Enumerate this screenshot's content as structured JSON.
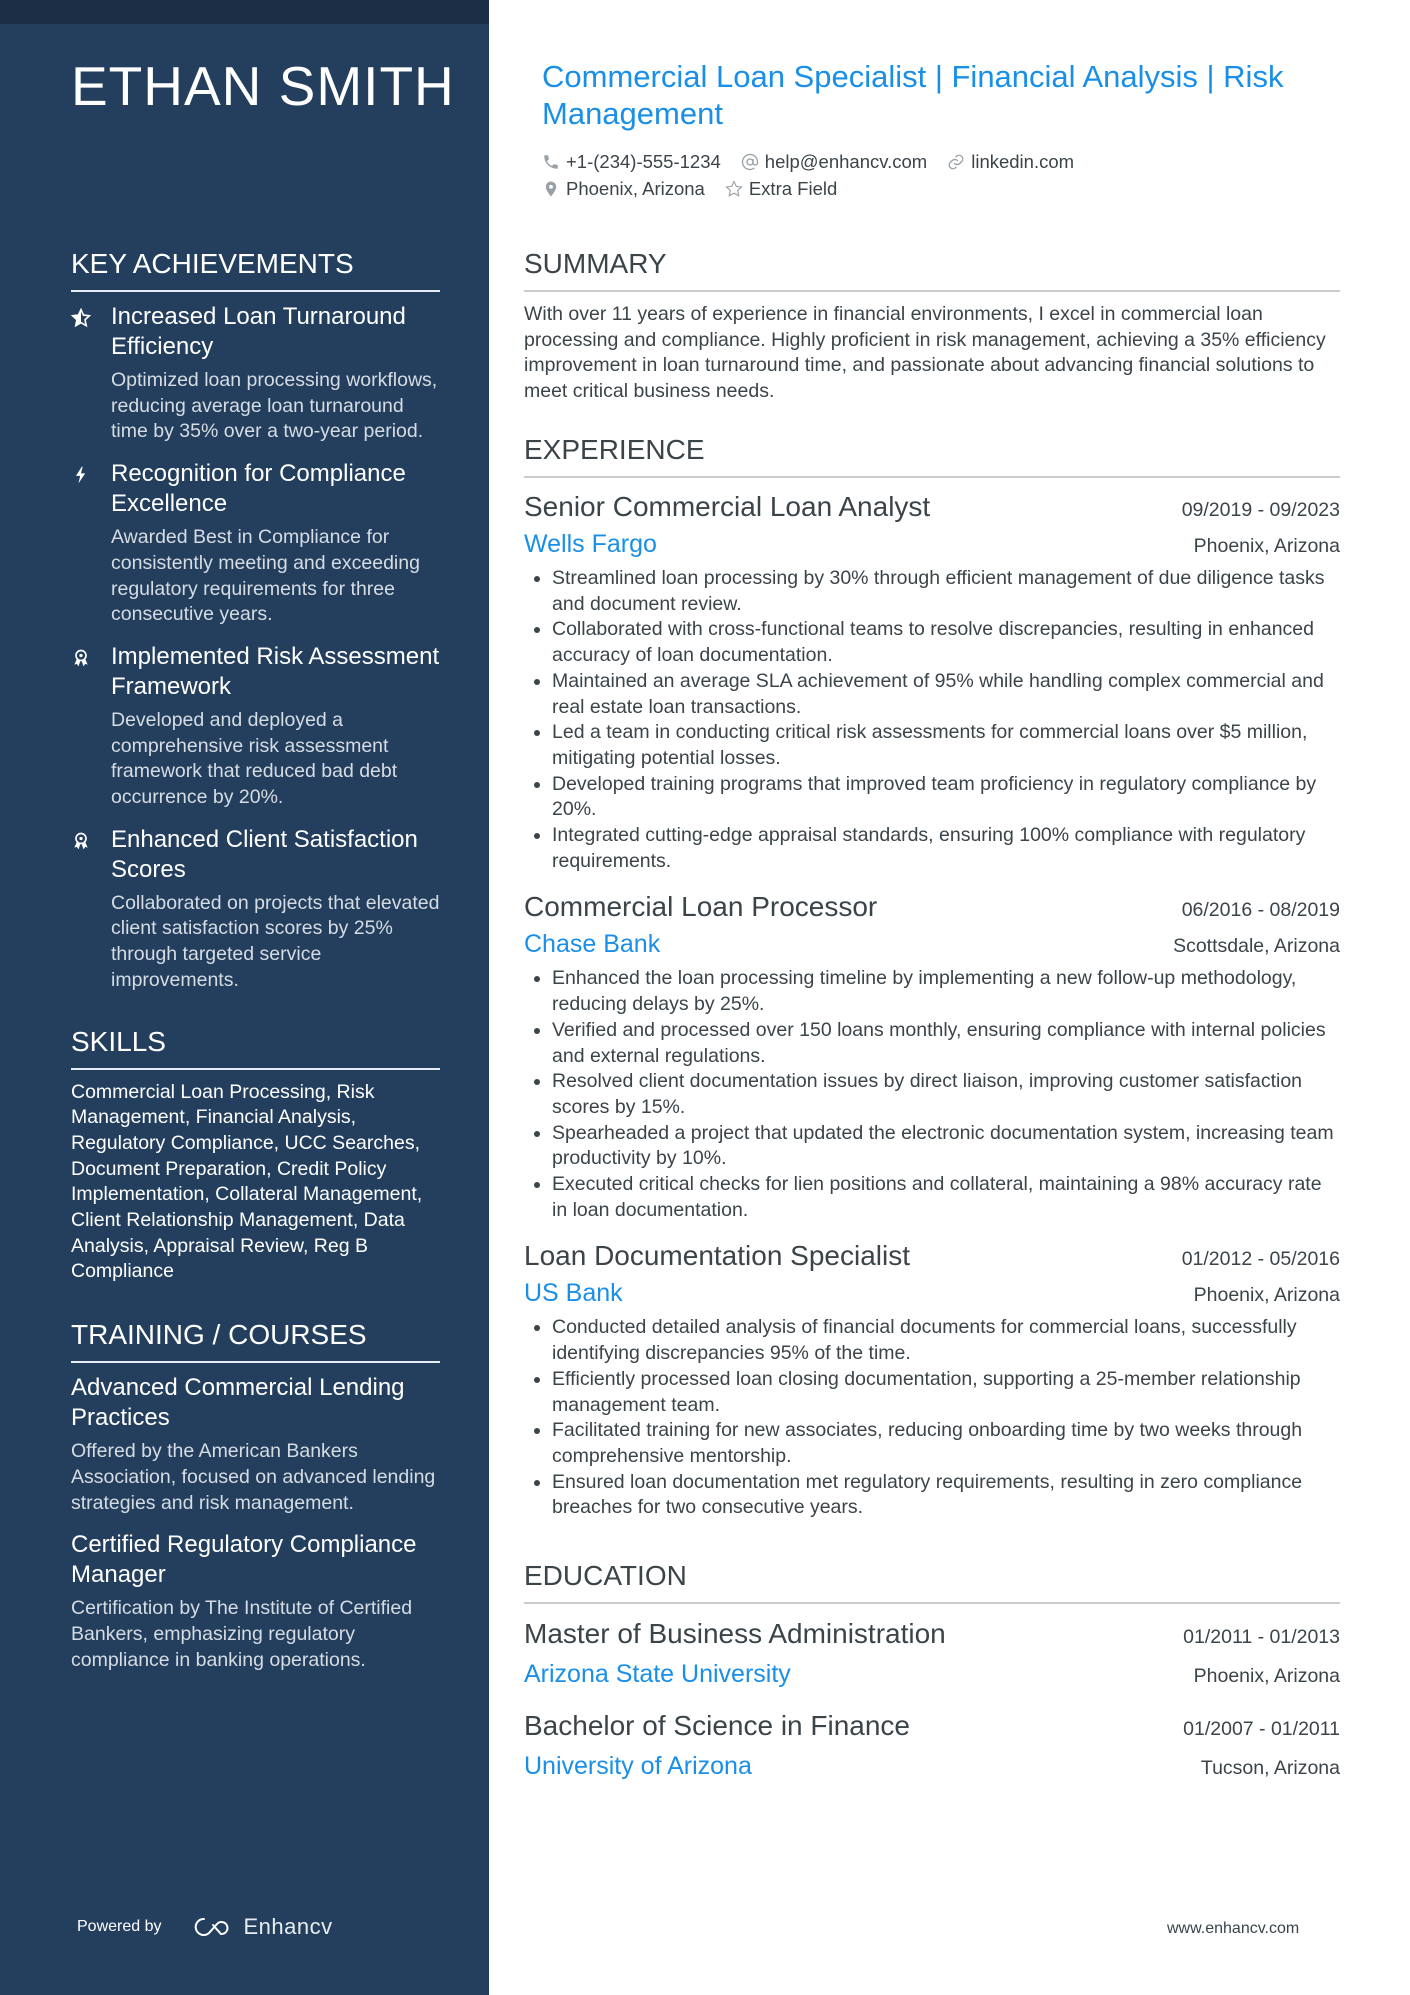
{
  "colors": {
    "sidebar_bg": "#233f5d",
    "sidebar_strip": "#1b2e45",
    "accent": "#1a8fe8",
    "text": "#3b4449"
  },
  "name": "ETHAN SMITH",
  "headline": "Commercial Loan Specialist | Financial Analysis | Risk Management",
  "contacts": {
    "phone": {
      "icon": "phone-icon",
      "value": "+1-(234)-555-1234"
    },
    "email": {
      "icon": "at-icon",
      "value": "help@enhancv.com"
    },
    "link": {
      "icon": "link-icon",
      "value": "linkedin.com"
    },
    "location": {
      "icon": "location-pin-icon",
      "value": "Phoenix, Arizona"
    },
    "extra": {
      "icon": "star-icon",
      "value": "Extra Field"
    }
  },
  "key_achievements": {
    "title": "KEY ACHIEVEMENTS",
    "items": [
      {
        "icon": "star-half-icon",
        "title": "Increased Loan Turnaround Efficiency",
        "description": "Optimized loan processing workflows, reducing average loan turnaround time by 35% over a two-year period."
      },
      {
        "icon": "lightning-icon",
        "title": "Recognition for Compliance Excellence",
        "description": "Awarded Best in Compliance for consistently meeting and exceeding regulatory requirements for three consecutive years."
      },
      {
        "icon": "award-ribbon-icon",
        "title": "Implemented Risk Assessment Framework",
        "description": "Developed and deployed a comprehensive risk assessment framework that reduced bad debt occurrence by 20%."
      },
      {
        "icon": "award-ribbon-icon",
        "title": "Enhanced Client Satisfaction Scores",
        "description": "Collaborated on projects that elevated client satisfaction scores by 25% through targeted service improvements."
      }
    ]
  },
  "skills": {
    "title": "SKILLS",
    "text": "Commercial Loan Processing, Risk Management, Financial Analysis, Regulatory Compliance, UCC Searches, Document Preparation, Credit Policy Implementation, Collateral Management, Client Relationship Management, Data Analysis, Appraisal Review, Reg B Compliance"
  },
  "training": {
    "title": "TRAINING / COURSES",
    "items": [
      {
        "title": "Advanced Commercial Lending Practices",
        "description": "Offered by the American Bankers Association, focused on advanced lending strategies and risk management."
      },
      {
        "title": "Certified Regulatory Compliance Manager",
        "description": "Certification by The Institute of Certified Bankers, emphasizing regulatory compliance in banking operations."
      }
    ]
  },
  "powered_by": {
    "label": "Powered by",
    "brand": "Enhancv"
  },
  "summary": {
    "title": "SUMMARY",
    "text": "With over 11 years of experience in financial environments, I excel in commercial loan processing and compliance. Highly proficient in risk management, achieving a 35% efficiency improvement in loan turnaround time, and passionate about advancing financial solutions to meet critical business needs."
  },
  "experience": {
    "title": "EXPERIENCE",
    "jobs": [
      {
        "title": "Senior Commercial Loan Analyst",
        "dates": "09/2019 - 09/2023",
        "company": "Wells Fargo",
        "location": "Phoenix, Arizona",
        "bullets": [
          "Streamlined loan processing by 30% through efficient management of due diligence tasks and document review.",
          "Collaborated with cross-functional teams to resolve discrepancies, resulting in enhanced accuracy of loan documentation.",
          "Maintained an average SLA achievement of 95% while handling complex commercial and real estate loan transactions.",
          "Led a team in conducting critical risk assessments for commercial loans over $5 million, mitigating potential losses.",
          "Developed training programs that improved team proficiency in regulatory compliance by 20%.",
          "Integrated cutting-edge appraisal standards, ensuring 100% compliance with regulatory requirements."
        ]
      },
      {
        "title": "Commercial Loan Processor",
        "dates": "06/2016 - 08/2019",
        "company": "Chase Bank",
        "location": "Scottsdale, Arizona",
        "bullets": [
          "Enhanced the loan processing timeline by implementing a new follow-up methodology, reducing delays by 25%.",
          "Verified and processed over 150 loans monthly, ensuring compliance with internal policies and external regulations.",
          "Resolved client documentation issues by direct liaison, improving customer satisfaction scores by 15%.",
          "Spearheaded a project that updated the electronic documentation system, increasing team productivity by 10%.",
          "Executed critical checks for lien positions and collateral, maintaining a 98% accuracy rate in loan documentation."
        ]
      },
      {
        "title": "Loan Documentation Specialist",
        "dates": "01/2012 - 05/2016",
        "company": "US Bank",
        "location": "Phoenix, Arizona",
        "bullets": [
          "Conducted detailed analysis of financial documents for commercial loans, successfully identifying discrepancies 95% of the time.",
          "Efficiently processed loan closing documentation, supporting a 25-member relationship management team.",
          "Facilitated training for new associates, reducing onboarding time by two weeks through comprehensive mentorship.",
          "Ensured loan documentation met regulatory requirements, resulting in zero compliance breaches for two consecutive years."
        ]
      }
    ]
  },
  "education": {
    "title": "EDUCATION",
    "items": [
      {
        "degree": "Master of Business Administration",
        "dates": "01/2011 - 01/2013",
        "school": "Arizona State University",
        "location": "Phoenix, Arizona"
      },
      {
        "degree": "Bachelor of Science in Finance",
        "dates": "01/2007 - 01/2011",
        "school": "University of Arizona",
        "location": "Tucson, Arizona"
      }
    ]
  },
  "footer_url": "www.enhancv.com"
}
